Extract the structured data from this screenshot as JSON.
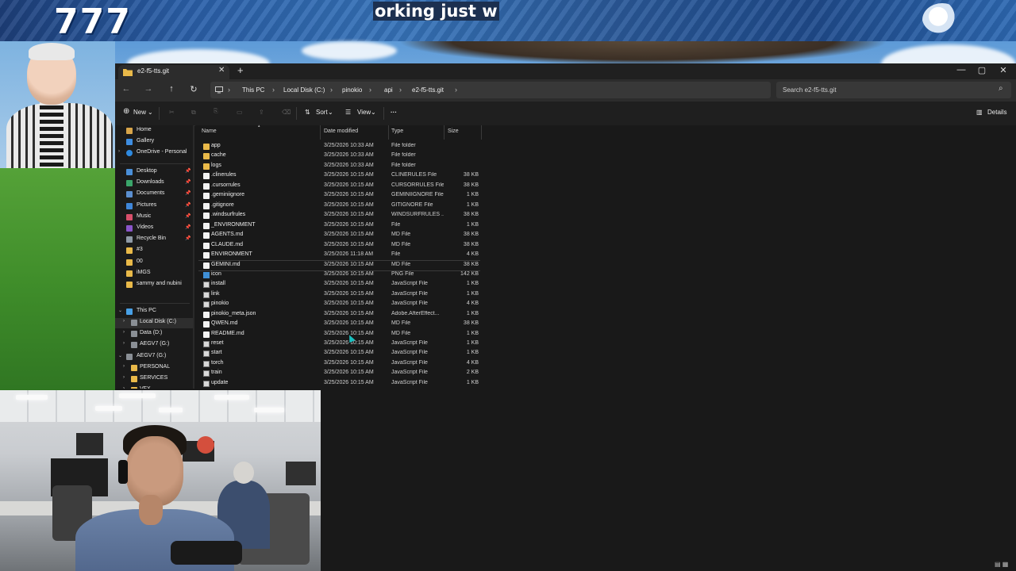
{
  "banner": {
    "left_text": "777",
    "caption": "orking just w"
  },
  "window": {
    "tab_title": "e2-f5-tts.git",
    "tab_close_glyph": "✕",
    "new_tab_glyph": "+",
    "controls": {
      "minimize": "—",
      "maximize": "▢",
      "close": "✕"
    }
  },
  "nav": {
    "back": "←",
    "forward": "→",
    "up": "↑",
    "refresh": "↻",
    "breadcrumbs": [
      "This PC",
      "Local Disk (C:)",
      "pinokio",
      "api",
      "e2-f5-tts.git"
    ],
    "separator": "›",
    "search_placeholder": "Search e2-f5-tts.git",
    "search_icon": "⌕"
  },
  "command_bar": {
    "new": "New",
    "sort": "Sort",
    "view": "View",
    "more": "···",
    "details": "Details",
    "dropdown": "⌄",
    "cut": "✂",
    "copy": "⧉",
    "paste": "📋",
    "rename": "▭",
    "share": "⇪",
    "delete": "🗑"
  },
  "sidebar": {
    "home": "Home",
    "gallery": "Gallery",
    "onedrive": "OneDrive - Personal",
    "quick": [
      {
        "label": "Desktop",
        "color": "#4a8fd8"
      },
      {
        "label": "Downloads",
        "color": "#3aa56a"
      },
      {
        "label": "Documents",
        "color": "#5b8fd0"
      },
      {
        "label": "Pictures",
        "color": "#3f86d9"
      },
      {
        "label": "Music",
        "color": "#d84f6b"
      },
      {
        "label": "Videos",
        "color": "#8a55c9"
      },
      {
        "label": "Recycle Bin",
        "color": "#8f9aa6"
      }
    ],
    "folders": [
      "#3",
      "00",
      "iMGS",
      "sammy and nubini"
    ],
    "this_pc": "This PC",
    "drives": [
      "Local Disk (C:)",
      "Data (D:)",
      "AEGV7 (G:)"
    ],
    "aegv": "AEGV7 (G:)",
    "aegv_children": [
      "PERSONAL",
      "SERVICES",
      "VFX"
    ]
  },
  "columns": {
    "name": "Name",
    "date": "Date modified",
    "type": "Type",
    "size": "Size"
  },
  "files": [
    {
      "name": "app",
      "date": "3/25/2026 10:33 AM",
      "type": "File folder",
      "size": "",
      "kind": "folder"
    },
    {
      "name": "cache",
      "date": "3/25/2026 10:33 AM",
      "type": "File folder",
      "size": "",
      "kind": "folder"
    },
    {
      "name": "logs",
      "date": "3/25/2026 10:33 AM",
      "type": "File folder",
      "size": "",
      "kind": "folder"
    },
    {
      "name": ".clinerules",
      "date": "3/25/2026 10:15 AM",
      "type": "CLINERULES File",
      "size": "38 KB",
      "kind": "doc"
    },
    {
      "name": ".cursorrules",
      "date": "3/25/2026 10:15 AM",
      "type": "CURSORRULES File",
      "size": "38 KB",
      "kind": "doc"
    },
    {
      "name": ".geminiignore",
      "date": "3/25/2026 10:15 AM",
      "type": "GEMINIIGNORE File",
      "size": "1 KB",
      "kind": "doc"
    },
    {
      "name": ".gitignore",
      "date": "3/25/2026 10:15 AM",
      "type": "GITIGNORE File",
      "size": "1 KB",
      "kind": "doc"
    },
    {
      "name": ".windsurfrules",
      "date": "3/25/2026 10:15 AM",
      "type": "WINDSURFRULES ...",
      "size": "38 KB",
      "kind": "doc"
    },
    {
      "name": "_ENVIRONMENT",
      "date": "3/25/2026 10:15 AM",
      "type": "File",
      "size": "1 KB",
      "kind": "doc"
    },
    {
      "name": "AGENTS.md",
      "date": "3/25/2026 10:15 AM",
      "type": "MD File",
      "size": "38 KB",
      "kind": "doc"
    },
    {
      "name": "CLAUDE.md",
      "date": "3/25/2026 10:15 AM",
      "type": "MD File",
      "size": "38 KB",
      "kind": "doc"
    },
    {
      "name": "ENVIRONMENT",
      "date": "3/25/2026 11:18 AM",
      "type": "File",
      "size": "4 KB",
      "kind": "doc"
    },
    {
      "name": "GEMINI.md",
      "date": "3/25/2026 10:15 AM",
      "type": "MD File",
      "size": "38 KB",
      "kind": "doc"
    },
    {
      "name": "icon",
      "date": "3/25/2026 10:15 AM",
      "type": "PNG File",
      "size": "142 KB",
      "kind": "png"
    },
    {
      "name": "install",
      "date": "3/25/2026 10:15 AM",
      "type": "JavaScript File",
      "size": "1 KB",
      "kind": "js"
    },
    {
      "name": "link",
      "date": "3/25/2026 10:15 AM",
      "type": "JavaScript File",
      "size": "1 KB",
      "kind": "js"
    },
    {
      "name": "pinokio",
      "date": "3/25/2026 10:15 AM",
      "type": "JavaScript File",
      "size": "4 KB",
      "kind": "js"
    },
    {
      "name": "pinokio_meta.json",
      "date": "3/25/2026 10:15 AM",
      "type": "Adobe.AfterEffect...",
      "size": "1 KB",
      "kind": "doc"
    },
    {
      "name": "QWEN.md",
      "date": "3/25/2026 10:15 AM",
      "type": "MD File",
      "size": "38 KB",
      "kind": "doc"
    },
    {
      "name": "README.md",
      "date": "3/25/2026 10:15 AM",
      "type": "MD File",
      "size": "1 KB",
      "kind": "doc"
    },
    {
      "name": "reset",
      "date": "3/25/2026 10:15 AM",
      "type": "JavaScript File",
      "size": "1 KB",
      "kind": "js"
    },
    {
      "name": "start",
      "date": "3/25/2026 10:15 AM",
      "type": "JavaScript File",
      "size": "1 KB",
      "kind": "js"
    },
    {
      "name": "torch",
      "date": "3/25/2026 10:15 AM",
      "type": "JavaScript File",
      "size": "4 KB",
      "kind": "js"
    },
    {
      "name": "train",
      "date": "3/25/2026 10:15 AM",
      "type": "JavaScript File",
      "size": "2 KB",
      "kind": "js"
    },
    {
      "name": "update",
      "date": "3/25/2026 10:15 AM",
      "type": "JavaScript File",
      "size": "1 KB",
      "kind": "js"
    }
  ],
  "hovered_row": "GEMINI.md",
  "status_icons": "▤ ▦"
}
